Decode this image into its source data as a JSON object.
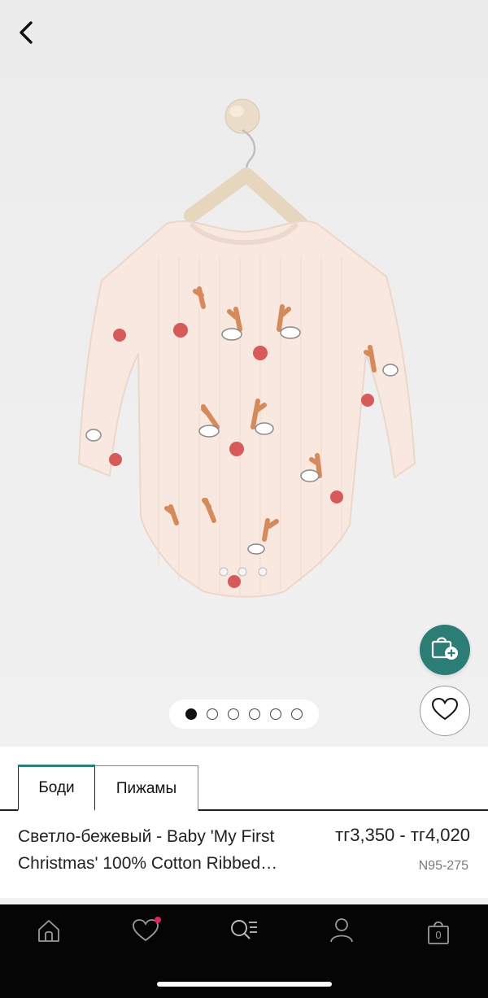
{
  "icons": {
    "back": "chevron-left-icon",
    "add_to_bag": "bag-plus-icon",
    "favorite": "heart-icon",
    "nav_home": "home-icon",
    "nav_favorites": "heart-icon",
    "nav_catalog": "search-menu-icon",
    "nav_profile": "user-icon",
    "nav_cart": "bag-icon"
  },
  "gallery": {
    "image_count": 6,
    "active_index": 0
  },
  "tabs": [
    {
      "label": "Боди",
      "active": true
    },
    {
      "label": "Пижамы",
      "active": false
    }
  ],
  "product": {
    "title": "Светло-бежевый - Baby 'My First Christmas' 100% Cotton Ribbed Long Sleeve Bodysuit",
    "price": "тг3,350 - тг4,020",
    "sku": "N95-275"
  },
  "cart": {
    "count": "0"
  },
  "colors": {
    "accent": "#2d7d77",
    "badge": "#e0245e",
    "nav_bg": "#050505"
  }
}
